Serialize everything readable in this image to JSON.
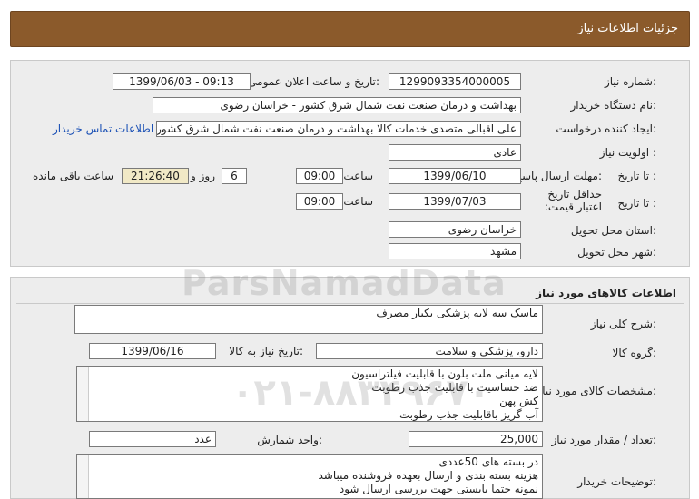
{
  "header": {
    "title": "جزئیات اطلاعات نیاز"
  },
  "info": {
    "need_number_label": "شماره نیاز:",
    "need_number": "1299093354000005",
    "announce_label": "تاریخ و ساعت اعلان عمومی:",
    "announce_value": "1399/06/03 - 09:13",
    "buyer_label": "نام دستگاه خریدار:",
    "buyer_value": "بهداشت و درمان صنعت نفت شمال شرق کشور - خراسان رضوی",
    "creator_label": "ایجاد کننده درخواست:",
    "creator_value": "علی اقبالی متصدی خدمات کالا بهداشت و درمان صنعت نفت شمال شرق کشور",
    "contact_link": "اطلاعات تماس خریدار",
    "priority_label": "اولویت نیاز :",
    "priority_value": "عادی",
    "send_deadline_label": "مهلت ارسال پاسخ:",
    "to_date_label": "تا تاریخ :",
    "send_date": "1399/06/10",
    "time_label": "ساعت",
    "send_time": "09:00",
    "days_value": "6",
    "days_label": "روز و",
    "remaining_time": "21:26:40",
    "remaining_label": "ساعت باقی مانده",
    "validity_label": "حداقل تاریخ اعتبار قیمت:",
    "validity_to_label": "تا تاریخ :",
    "validity_date": "1399/07/03",
    "validity_time_label": "ساعت",
    "validity_time": "09:00",
    "province_label": "استان محل تحویل:",
    "province_value": "خراسان رضوی",
    "city_label": "شهر محل تحویل:",
    "city_value": "مشهد"
  },
  "goods": {
    "section_title": "اطلاعات کالاهای مورد نیاز",
    "summary_label": "شرح کلی نیاز:",
    "summary_value": "ماسک سه لایه پزشکی یکبار مصرف",
    "group_label": "گروه کالا:",
    "group_value": "دارو، پزشکی و سلامت",
    "need_date_label": "تاریخ نیاز به کالا:",
    "need_date": "1399/06/16",
    "specs_label": "مشخصات کالای مورد نیاز:",
    "specs_lines": [
      "لایه میانی ملت بلون با قابلیت فیلتراسیون",
      "ضد حساسیت با قابلیت جذب رطوبت",
      "کش پهن",
      "آب گریز باقابلیت جذب رطوبت"
    ],
    "qty_label": "تعداد / مقدار مورد نیاز:",
    "qty_value": "25,000",
    "unit_label": "واحد شمارش:",
    "unit_value": "عدد",
    "buyer_notes_label": "توضیحات خریدار:",
    "notes_lines": [
      "در بسته های 50عددی",
      "هزینه بسته بندی و ارسال بعهده فروشنده میباشد",
      "نمونه حتما بایستی جهت بررسی ارسال شود"
    ]
  },
  "watermark": {
    "brand": "ParsNamadData",
    "phone": "۰۲۱-۸۸۳۴۹۶۷۰"
  }
}
